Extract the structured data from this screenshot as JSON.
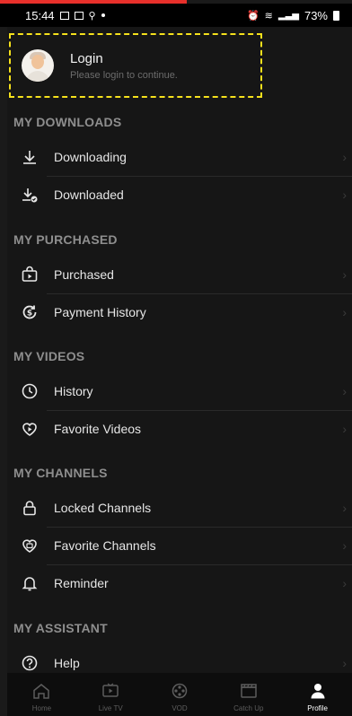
{
  "status_bar": {
    "time": "15:44",
    "battery": "73%"
  },
  "login": {
    "title": "Login",
    "subtitle": "Please login to continue."
  },
  "sections": [
    {
      "title": "MY DOWNLOADS",
      "items": [
        {
          "label": "Downloading",
          "icon": "download-icon"
        },
        {
          "label": "Downloaded",
          "icon": "downloaded-icon"
        }
      ]
    },
    {
      "title": "MY PURCHASED",
      "items": [
        {
          "label": "Purchased",
          "icon": "shopping-bag-icon"
        },
        {
          "label": "Payment History",
          "icon": "payment-history-icon"
        }
      ]
    },
    {
      "title": "MY VIDEOS",
      "items": [
        {
          "label": "History",
          "icon": "clock-icon"
        },
        {
          "label": "Favorite Videos",
          "icon": "heart-play-icon"
        }
      ]
    },
    {
      "title": "MY CHANNELS",
      "items": [
        {
          "label": "Locked Channels",
          "icon": "lock-icon"
        },
        {
          "label": "Favorite Channels",
          "icon": "heart-tv-icon"
        },
        {
          "label": "Reminder",
          "icon": "bell-icon"
        }
      ]
    },
    {
      "title": "MY ASSISTANT",
      "items": [
        {
          "label": "Help",
          "icon": "help-icon"
        }
      ]
    }
  ],
  "bottom_nav": [
    {
      "label": "Home",
      "icon": "home-icon",
      "active": false
    },
    {
      "label": "Live TV",
      "icon": "live-tv-icon",
      "active": false
    },
    {
      "label": "VOD",
      "icon": "film-reel-icon",
      "active": false
    },
    {
      "label": "Catch Up",
      "icon": "clapperboard-icon",
      "active": false
    },
    {
      "label": "Profile",
      "icon": "profile-icon",
      "active": true
    }
  ],
  "chevron": "›",
  "colors": {
    "accent": "#e8302b",
    "highlight": "#f5e11c",
    "background": "#161616"
  }
}
